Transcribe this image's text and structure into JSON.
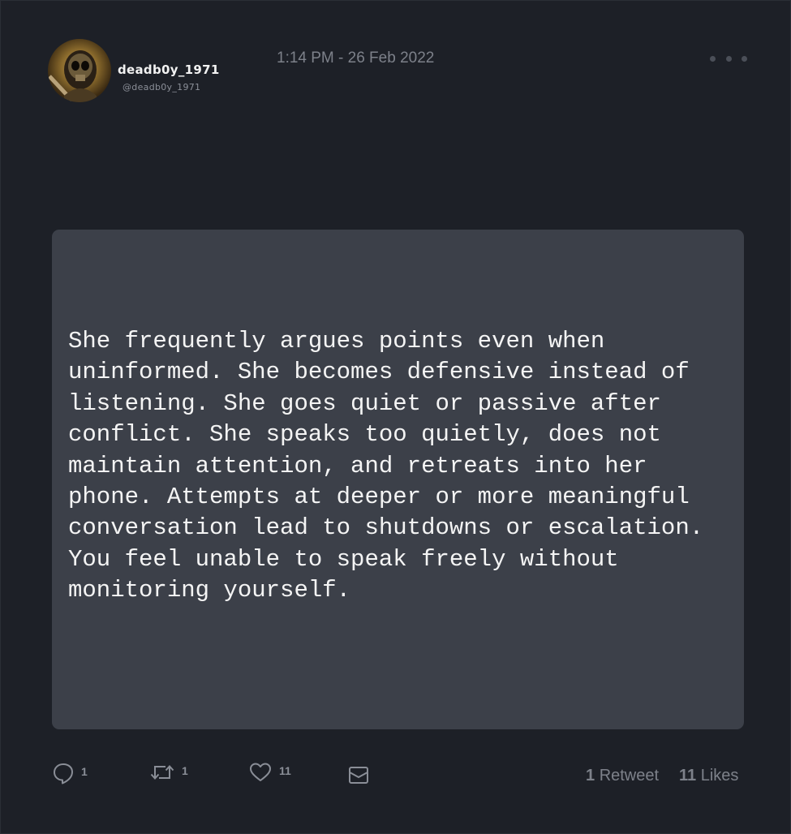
{
  "tweet": {
    "display_name": "deadb0y_1971",
    "handle": "@deadb0y_1971",
    "timestamp": "1:14 PM - 26 Feb 2022",
    "body": "She frequently argues points even when uninformed. She becomes defensive instead of listening. She goes quiet or passive after conflict. She speaks too quietly, does not maintain attention, and retreats into her phone. Attempts at deeper or more meaningful conversation lead to shutdowns or escalation. You feel unable to speak freely without monitoring yourself."
  },
  "actions": {
    "reply_icon": "speech-bubble-icon",
    "reply_count": "1",
    "retweet_icon": "retweet-arrows-icon",
    "retweet_count": "1",
    "like_icon": "heart-icon",
    "like_count": "11",
    "dm_icon": "envelope-icon",
    "more_icon": "ellipsis-icon"
  },
  "stats": {
    "retweets_number": "1",
    "retweets_label": "Retweet",
    "likes_number": "11",
    "likes_label": "Likes"
  },
  "colors": {
    "background": "#1d2027",
    "content_box": "#3c4049",
    "text": "#f4f4f4",
    "muted": "#7d818a"
  }
}
